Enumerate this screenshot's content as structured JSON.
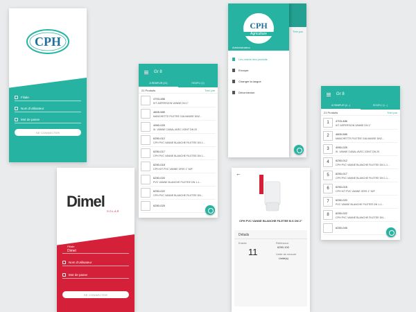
{
  "cph_login": {
    "logo": "CPH",
    "fields": [
      "Filiale",
      "Nom d'utilisateur",
      "Mot de passe"
    ],
    "button": "SE CONNECTER"
  },
  "dimel_login": {
    "logo": "Dimel",
    "logo_sub": "SOLAR",
    "filiale_label": "Filiale",
    "filiale_value": "Dimel",
    "fields": [
      "Nom d'utilisateur",
      "Mot de passe"
    ],
    "button": "SE CONNECTER"
  },
  "list_screen": {
    "title": "Gr 8",
    "tabs": [
      "À REMPLIR (21)",
      "REMPLI (0)"
    ],
    "count": "21 Produits",
    "sort": "Trier par",
    "items": [
      {
        "code": "4703-486",
        "desc": "KIT ASPERSION VANNE DN 1\""
      },
      {
        "code": "4805-585",
        "desc": "MANCHETTE FILETEE GALVANISE DN2..."
      },
      {
        "code": "4950-025",
        "desc": "IK. VANNE CANAL AVEC JOINT DN 20"
      },
      {
        "code": "6250-012",
        "desc": "CPH PVC VANNE BLANCHE FILETEE DN 1..."
      },
      {
        "code": "6250-017",
        "desc": "CPH PVC VANNE BLANCHE FILETEE DN 1..."
      },
      {
        "code": "6250-018",
        "desc": "CPH KIT PVC VANNE GRIS 1\" M/F"
      },
      {
        "code": "6250-020",
        "desc": "PVC VANNE BLANCHE FILETEE DN 1-1..."
      },
      {
        "code": "6250-022",
        "desc": "CPH PVC VANNE BLANCHE FILETEE DN..."
      },
      {
        "code": "6250-025",
        "desc": ""
      }
    ]
  },
  "drawer_screen": {
    "logo": "CPH",
    "logo_sub": "Agriculture",
    "user": "Administrateur",
    "sort": "Trier par",
    "menu": [
      "Les ordres des produits",
      "Envoyer",
      "Changer la langue",
      "Déconnexion"
    ]
  },
  "product_screen": {
    "name": "CPH PVC VANNE BLANCHE FILETEE B.S DN 2\"",
    "details_title": "Détails",
    "entree_label": "Entrée",
    "entree_value": "11",
    "ref_label": "Référence",
    "ref_value": "6250-100",
    "unit_label": "Unité de mesure",
    "unit_value": "Unité(s)"
  },
  "numbered_screen": {
    "title": "Gr 8",
    "tabs": [
      "À REMPLIR (2...)",
      "REMPLI (1...)"
    ],
    "count": "21 Produits",
    "sort": "Trier par",
    "items": [
      {
        "n": "1",
        "code": "4703-486",
        "desc": "KIT ASPERSION VANNE DN 1\""
      },
      {
        "n": "2",
        "code": "4805-585",
        "desc": "MANCHETTE FILETEE GALVANISE DN2..."
      },
      {
        "n": "3",
        "code": "4950-025",
        "desc": "IK. VANNE CANAL AVEC JOINT DN 20"
      },
      {
        "n": "4",
        "code": "6250-012",
        "desc": "CPH PVC VANNE BLANCHE FILETEE DN 1-1..."
      },
      {
        "n": "5",
        "code": "6250-017",
        "desc": "CPH PVC VANNE BLANCHE FILETEE DN 1-1..."
      },
      {
        "n": "6",
        "code": "6250-018",
        "desc": "CPH KIT PVC VANNE GRIS 1\" M/F"
      },
      {
        "n": "7",
        "code": "6250-020",
        "desc": "PVC VANNE BLANCHE FILETEE DN 1-1..."
      },
      {
        "n": "8",
        "code": "6250-022",
        "desc": "CPH PVC VANNE BLANCHE FILETEE DN..."
      },
      {
        "n": "",
        "code": "6250-045",
        "desc": ""
      }
    ]
  },
  "colors": {
    "teal": "#27b3a1",
    "red": "#d5203a"
  }
}
